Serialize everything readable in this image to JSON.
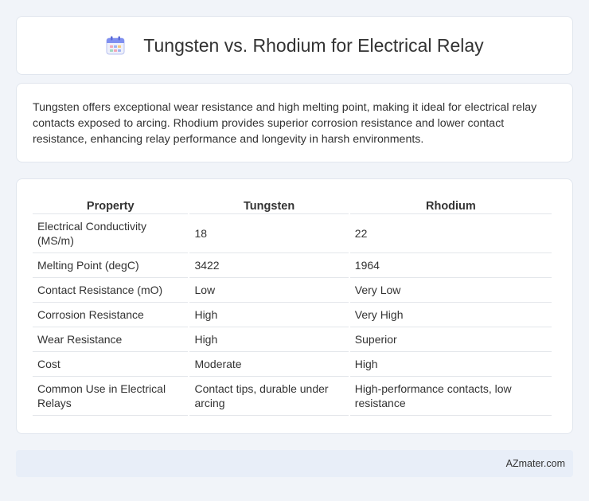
{
  "header": {
    "title": "Tungsten vs. Rhodium for Electrical Relay",
    "icon": "calendar-icon"
  },
  "description": "Tungsten offers exceptional wear resistance and high melting point, making it ideal for electrical relay contacts exposed to arcing. Rhodium provides superior corrosion resistance and lower contact resistance, enhancing relay performance and longevity in harsh environments.",
  "table": {
    "headers": [
      "Property",
      "Tungsten",
      "Rhodium"
    ],
    "rows": [
      [
        "Electrical Conductivity (MS/m)",
        "18",
        "22"
      ],
      [
        "Melting Point (degC)",
        "3422",
        "1964"
      ],
      [
        "Contact Resistance (mO)",
        "Low",
        "Very Low"
      ],
      [
        "Corrosion Resistance",
        "High",
        "Very High"
      ],
      [
        "Wear Resistance",
        "High",
        "Superior"
      ],
      [
        "Cost",
        "Moderate",
        "High"
      ],
      [
        "Common Use in Electrical Relays",
        "Contact tips, durable under arcing",
        "High-performance contacts, low resistance"
      ]
    ]
  },
  "footer": {
    "brand": "AZmater.com"
  }
}
